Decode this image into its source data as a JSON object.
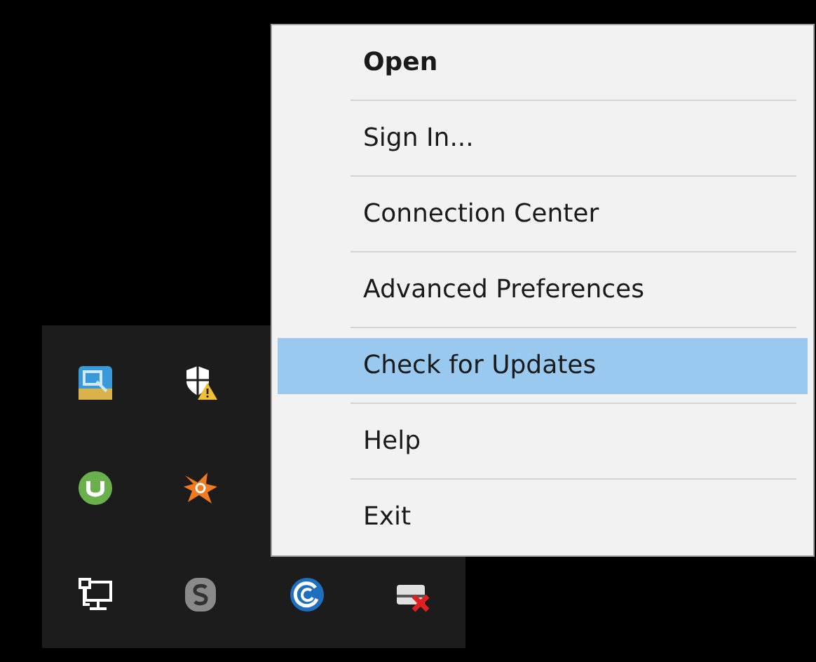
{
  "context_menu": {
    "items": [
      {
        "label": "Open",
        "kind": "default",
        "selected": false
      },
      {
        "label": "Sign In...",
        "kind": "normal",
        "selected": false
      },
      {
        "label": "Connection Center",
        "kind": "normal",
        "selected": false
      },
      {
        "label": "Advanced Preferences",
        "kind": "normal",
        "selected": false
      },
      {
        "label": "Check for Updates",
        "kind": "normal",
        "selected": true
      },
      {
        "label": "Help",
        "kind": "normal",
        "selected": false
      },
      {
        "label": "Exit",
        "kind": "normal",
        "selected": false
      }
    ]
  }
}
